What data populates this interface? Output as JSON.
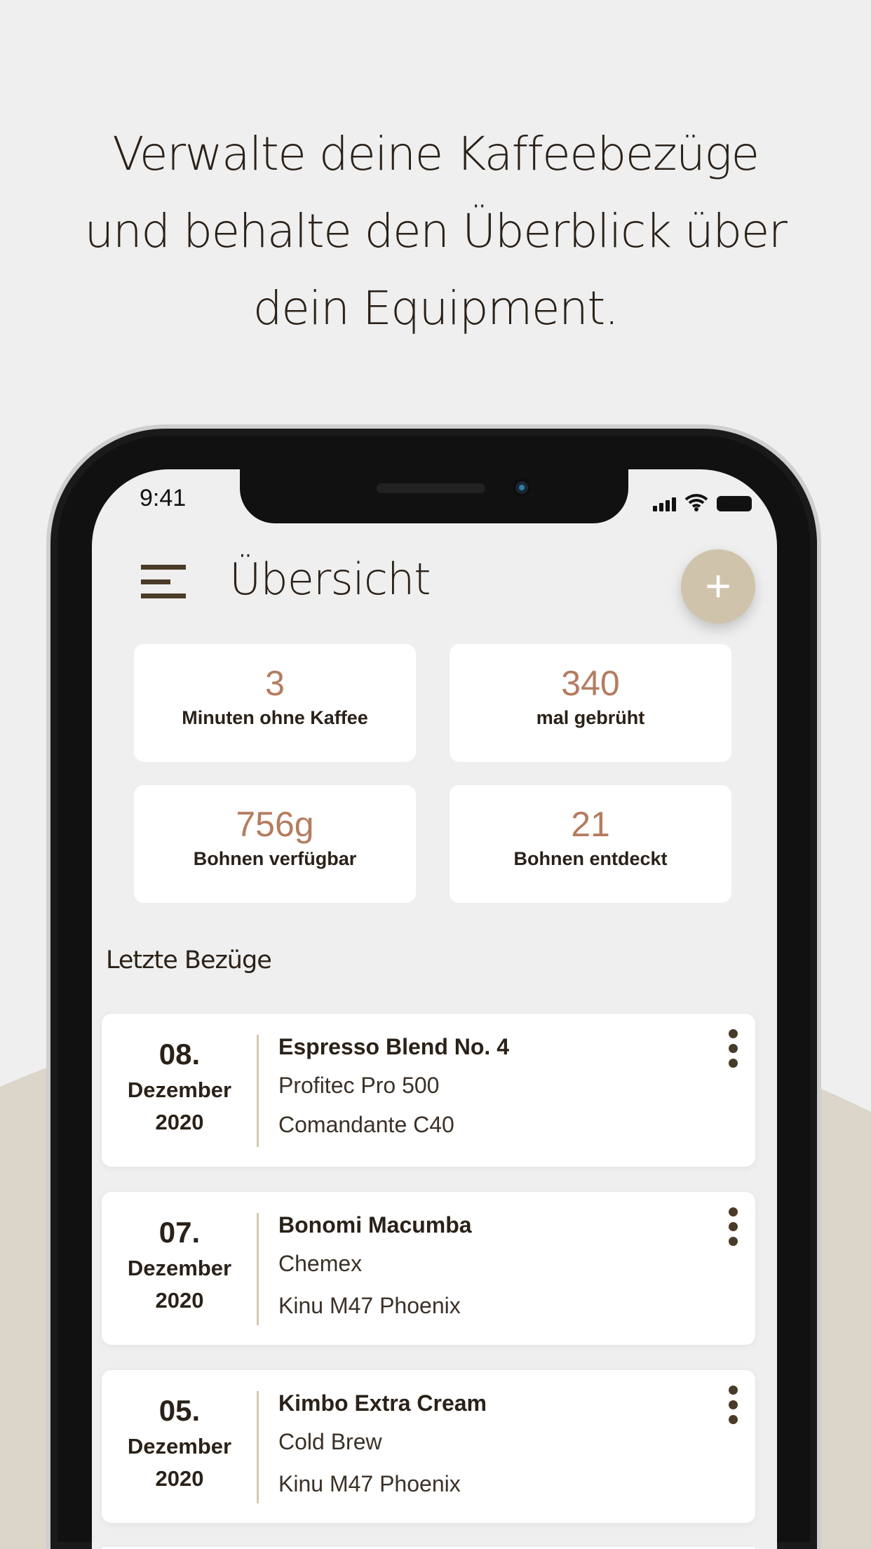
{
  "headline": [
    "Verwalte deine Kaffeebezüge",
    "und behalte den Überblick über",
    "dein Equipment."
  ],
  "status_bar": {
    "time": "9:41"
  },
  "header": {
    "title": "Übersicht",
    "add_label": "+"
  },
  "stats": [
    {
      "value": "3",
      "label": "Minuten ohne Kaffee"
    },
    {
      "value": "340",
      "label": "mal gebrüht"
    },
    {
      "value": "756g",
      "label": "Bohnen verfügbar"
    },
    {
      "value": "21",
      "label": "Bohnen entdeckt"
    }
  ],
  "section_title": "Letzte Bezüge",
  "entries": [
    {
      "day": "08.",
      "month": "Dezember",
      "year": "2020",
      "name": "Espresso Blend No. 4",
      "method": "Profitec Pro 500",
      "grinder": "Comandante C40"
    },
    {
      "day": "07.",
      "month": "Dezember",
      "year": "2020",
      "name": "Bonomi Macumba",
      "method": "Chemex",
      "grinder": "Kinu M47 Phoenix"
    },
    {
      "day": "05.",
      "month": "Dezember",
      "year": "2020",
      "name": "Kimbo Extra Cream",
      "method": "Cold Brew",
      "grinder": "Kinu M47 Phoenix"
    }
  ],
  "colors": {
    "accent": "#b47c5f",
    "fab": "#cfc3ab",
    "background_shape": "#dcd5c9",
    "text": "#2a2118"
  }
}
